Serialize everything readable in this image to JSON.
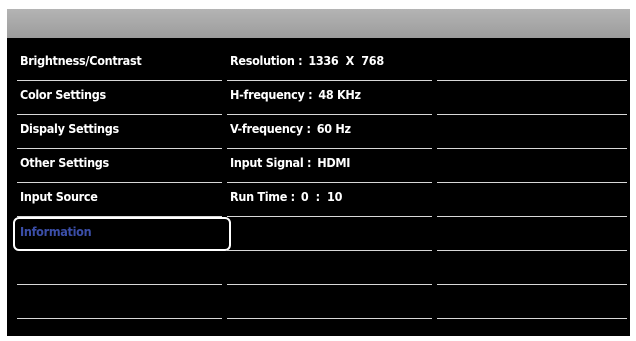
{
  "menu": {
    "items": [
      {
        "label": "Brightness/Contrast"
      },
      {
        "label": "Color Settings"
      },
      {
        "label": "Dispaly Settings"
      },
      {
        "label": "Other Settings"
      },
      {
        "label": "Input Source"
      },
      {
        "label": "Information",
        "selected": true
      }
    ]
  },
  "info": {
    "resolution_label": "Resolution :",
    "resolution_value": "1336  X  768",
    "hfreq_label": "H-frequency :",
    "hfreq_value": "48 KHz",
    "vfreq_label": "V-frequency :",
    "vfreq_value": "60 Hz",
    "signal_label": "Input Signal :",
    "signal_value": "HDMI",
    "runtime_label": "Run Time :",
    "runtime_value": "0  :  10"
  },
  "colors": {
    "background": "#000000",
    "titlebar": "#aaaaaa",
    "text": "#ffffff",
    "selected_text": "#3b4ea8",
    "divider": "#d8d8d8"
  }
}
